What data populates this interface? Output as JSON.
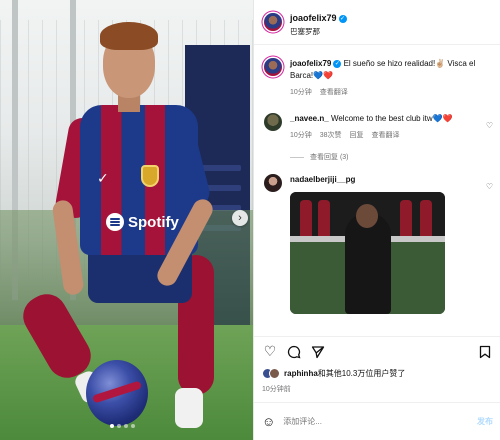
{
  "post": {
    "username": "joaofelix79",
    "location": "巴塞罗那"
  },
  "caption": {
    "username": "joaofelix79",
    "text": "El sueño se hizo realidad!✌🏼 Visca el Barca!💙❤️",
    "time": "10分钟",
    "translate": "查看翻译"
  },
  "comments": [
    {
      "username": "_navee.n_",
      "text": "Welcome to the best club itw💙❤️",
      "time": "10分钟",
      "likes": "38次赞",
      "reply": "回复",
      "translate": "查看翻译",
      "view_replies": "查看回复 (3)"
    },
    {
      "username": "nadaelberjiji__pg",
      "text": ""
    }
  ],
  "photo": {
    "sponsor": "Spotify"
  },
  "likes": {
    "text_user": "raphinha",
    "text_rest": "和其他10.3万位用户赞了"
  },
  "timestamp": "10分钟前",
  "comment_box": {
    "placeholder": "添加评论...",
    "post_label": "发布"
  },
  "icons": {
    "like": "heart-icon",
    "comment": "comment-icon",
    "share": "share-icon",
    "save": "bookmark-icon",
    "emoji": "emoji-icon",
    "next": "chevron-right-icon"
  },
  "colors": {
    "verified": "#0095f6",
    "barca_blue": "#1d3a8a",
    "barca_red": "#a5133b"
  }
}
